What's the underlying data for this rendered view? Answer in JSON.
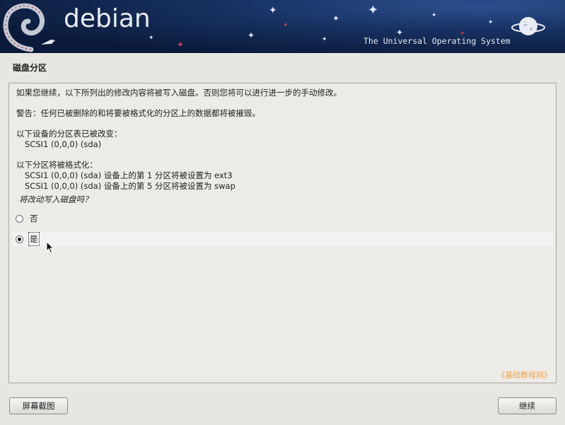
{
  "banner": {
    "logo_text": "debian",
    "tagline": "The Universal Operating System"
  },
  "page_title": "磁盘分区",
  "content": {
    "intro": "如果您继续，以下所列出的修改内容将被写入磁盘。否则您将可以进行进一步的手动修改。",
    "warning": "警告：任何已被删除的和将要被格式化的分区上的数据都将被摧毁。",
    "table_change_heading": "以下设备的分区表已被改变：",
    "table_change_device": "SCSI1 (0,0,0) (sda)",
    "format_heading": "以下分区将被格式化：",
    "format_items": [
      "SCSI1 (0,0,0) (sda) 设备上的第 1 分区将被设置为 ext3",
      "SCSI1 (0,0,0) (sda) 设备上的第 5 分区将被设置为 swap"
    ],
    "question": "将改动写入磁盘吗？",
    "options": [
      {
        "label": "否",
        "selected": false
      },
      {
        "label": "是",
        "selected": true
      }
    ],
    "watermark": "《基础教程网》"
  },
  "buttons": {
    "screenshot": "屏幕截图",
    "continue": "继续"
  }
}
